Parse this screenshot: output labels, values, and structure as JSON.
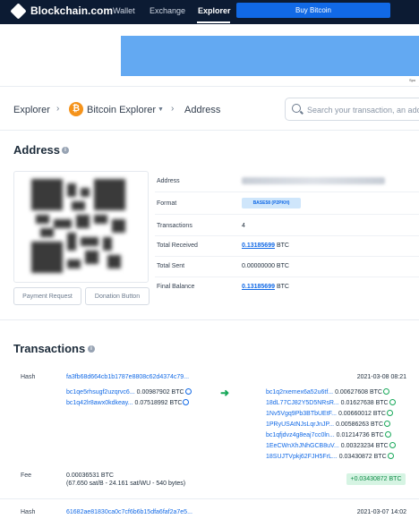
{
  "nav": {
    "brand": "Blockchain.com",
    "wallet": "Wallet",
    "exchange": "Exchange",
    "explorer": "Explorer",
    "buy": "Buy Bitcoin"
  },
  "breadcrumb": {
    "root": "Explorer",
    "explorer": "Bitcoin Explorer",
    "current": "Address"
  },
  "search": {
    "placeholder": "Search your transaction, an addre"
  },
  "address": {
    "heading": "Address",
    "buttons": {
      "payment": "Payment Request",
      "donation": "Donation Button"
    },
    "rows": {
      "address_label": "Address",
      "format_label": "Format",
      "format_value": "BASE58 (P2PKH)",
      "tx_label": "Transactions",
      "tx_value": "4",
      "received_label": "Total Received",
      "received_value": "0.13185699",
      "received_unit": "BTC",
      "sent_label": "Total Sent",
      "sent_value": "0.00000000 BTC",
      "balance_label": "Final Balance",
      "balance_value": "0.13185699",
      "balance_unit": "BTC"
    }
  },
  "transactions": {
    "heading": "Transactions",
    "hash_label": "Hash",
    "fee_label": "Fee",
    "tx1": {
      "hash": "fa3fb68d664cb1b1787e8808c62d4374c79...",
      "date": "2021-03-08 08:21",
      "inputs": [
        {
          "addr": "bc1qe5rhsugf2uzqrvc6...",
          "amt": "0.00987902 BTC"
        },
        {
          "addr": "bc1q42lr8awx0kdkeay...",
          "amt": "0.07518992 BTC"
        }
      ],
      "outputs": [
        {
          "addr": "bc1q2rxemex6a52u6tf...",
          "amt": "0.00627608 BTC"
        },
        {
          "addr": "18dL77CJ82Y5D5NRsR...",
          "amt": "0.01627638 BTC"
        },
        {
          "addr": "1Nv5Vgq9Pb3BTbUEtF...",
          "amt": "0.00660012 BTC"
        },
        {
          "addr": "1PRyUSAtNJsLqrJnJP...",
          "amt": "0.00586263 BTC"
        },
        {
          "addr": "bc1qfjdvz4g8eaj7cc0ln...",
          "amt": "0.01214736 BTC"
        },
        {
          "addr": "1EeCWnXhJNhGCB8uV...",
          "amt": "0.00323234 BTC"
        },
        {
          "addr": "18SUJTVpkj62FJH5FrL...",
          "amt": "0.03430872 BTC"
        }
      ],
      "fee": "0.00036531 BTC",
      "fee_detail": "(67.650 sat/B - 24.161 sat/WU - 540 bytes)",
      "net": "+0.03430872 BTC"
    },
    "tx2": {
      "hash": "61682ae81830ca0c7cf6b6b15dfa6faf2a7e5...",
      "date": "2021-03-07 14:02"
    }
  },
  "colors": {
    "nav_bg": "#0c1b33",
    "accent": "#1169e6",
    "banner": "#63a9f2",
    "positive": "#18a85a",
    "bitcoin": "#f5931b"
  },
  "icons": [
    "logo-icon",
    "bitcoin-icon",
    "chevron-right-icon",
    "chevron-down-icon",
    "search-icon",
    "info-icon",
    "qr-code",
    "globe-icon",
    "arrow-right-icon"
  ]
}
